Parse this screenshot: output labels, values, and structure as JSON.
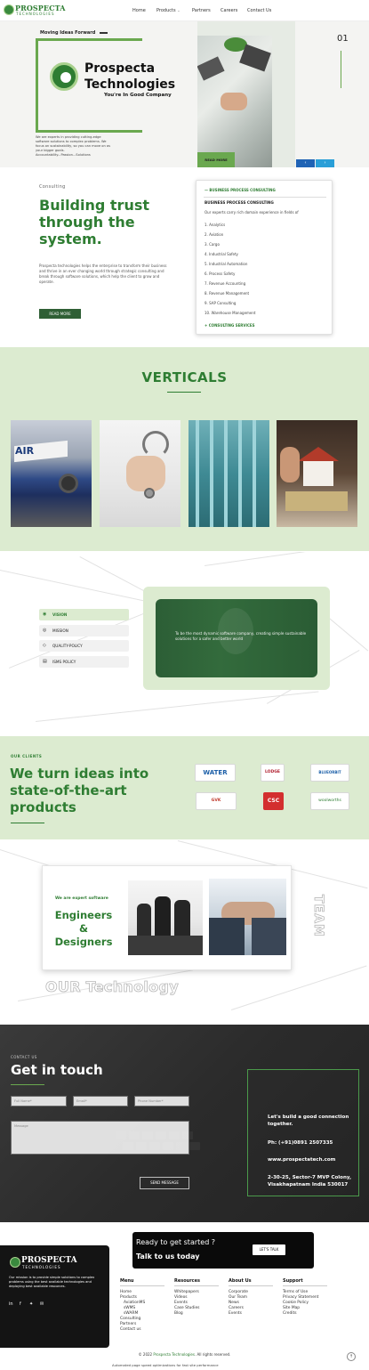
{
  "nav": {
    "logo_main": "PROSPECTA",
    "logo_sub": "TECHNOLOGIES",
    "links": [
      "Home",
      "Products",
      "Partners",
      "Careers",
      "Contact Us"
    ],
    "products_chevron": "chevron-down-icon"
  },
  "hero": {
    "tagline": "Moving Ideas Forward",
    "title_line1": "Prospecta",
    "title_line2": "Technologies",
    "subtitle": "You're In Good Company",
    "description": "We are experts in providing cutting-edge software solutions to complex problems. We focus on sustainability, so you can move on as your bigger goals. Accountability...Passion...Solutions",
    "read_more": "READ MORE",
    "slide_number": "01",
    "prev_icon": "arrow-left-icon",
    "next_icon": "arrow-right-icon"
  },
  "consulting": {
    "label": "Consulting",
    "title": "Building trust through the system.",
    "description": "Prospecta technologies helps the enterprise to transform their business and thrive in an ever changing world through strategic consulting and break through software solutions, which help the client to grow and operate.",
    "read_more": "READ MORE",
    "accordion": {
      "header": "BUSINESS PROCESS CONSULTING",
      "subheader": "BUSINESS PROCESS CONSULTING",
      "intro": "Our experts carry rich domain experience in fields of",
      "items": [
        "1. Analytics",
        "2. Aviation",
        "3. Cargo",
        "4. Industrial Safety",
        "5. Industrial Automation",
        "6. Process Safety",
        "7. Revenue Accounting",
        "8. Revenue Management",
        "9. SAP Consulting",
        "10. Warehouse Management"
      ],
      "footer": "CONSULTING SERVICES"
    }
  },
  "verticals": {
    "title": "VERTICALS",
    "images": [
      "aviation-image",
      "healthcare-image",
      "warehouse-image",
      "real-estate-image"
    ]
  },
  "vision": {
    "tabs": [
      {
        "label": "VISION",
        "icon": "eye-icon"
      },
      {
        "label": "MISSION",
        "icon": "target-icon"
      },
      {
        "label": "QUALITY-POLICY",
        "icon": "diamond-icon"
      },
      {
        "label": "ISMS POLICY",
        "icon": "document-icon"
      }
    ],
    "active_tab": "VISION",
    "text": "To be the most dynamic software company, creating simple sustainable solutions for a safer and better world"
  },
  "clients": {
    "label": "OUR CLIENTS",
    "title": "We turn ideas into state-of-the-art products",
    "logos": [
      "WATER",
      "LODGE",
      "BLUEORBIT",
      "GVK",
      "CSC",
      "woolworths"
    ]
  },
  "team": {
    "small": "We are expert software",
    "big": "Engineers & Designers",
    "vertical_label": "TEAM",
    "tech_label": "OUR Technology"
  },
  "contact": {
    "label": "CONTACT US",
    "title": "Get in touch",
    "placeholders": {
      "name": "Full Name*",
      "email": "Email*",
      "phone": "Phone Number*",
      "message": "Message"
    },
    "send": "SEND MESSAGE",
    "info": {
      "heading": "Let's build a good connection together.",
      "phone": "Ph: (+91)0891 2507335",
      "website": "www.prospectatech.com",
      "address": "2-30-25, Sector-7 MVP Colony, Visakhapatnam India 530017"
    }
  },
  "footer": {
    "logo_main": "PROSPECTA",
    "logo_sub": "TECHNOLOGIES",
    "description": "Our mission is to provide simple solutions to complex problems using the best available technologies and deploying best available resources.",
    "social": [
      "linkedin-icon",
      "facebook-icon",
      "twitter-icon",
      "email-icon"
    ],
    "cta_line1": "Ready to get started ?",
    "cta_line2": "Talk to us today",
    "cta_button": "LET'S TALK",
    "columns": [
      {
        "heading": "Menu",
        "items": [
          "Home",
          "Products",
          "AviationMS",
          "sWMS",
          "sWARM",
          "Consulting",
          "Partners",
          "Contact us"
        ]
      },
      {
        "heading": "Resources",
        "items": [
          "Whitepapers",
          "Videos",
          "Events",
          "Case Studies",
          "Blog"
        ]
      },
      {
        "heading": "About Us",
        "items": [
          "Corporate",
          "Our Team",
          "News",
          "Careers",
          "Events"
        ]
      },
      {
        "heading": "Support",
        "items": [
          "Terms of Use",
          "Privacy Statement",
          "Cookie Policy",
          "Site Map",
          "Credits"
        ]
      }
    ],
    "copyright_prefix": "© 2022",
    "copyright_link": "Prospecta Technologies",
    "copyright_suffix": ". All rights reserved.",
    "auto_text": "Automated page speed optimizations for fast site performance",
    "up_icon": "arrow-up-icon"
  },
  "colors": {
    "brand_green": "#2e7d32",
    "light_green": "#dcebd0",
    "accent_green": "#6aa84f",
    "dark": "#141414"
  }
}
